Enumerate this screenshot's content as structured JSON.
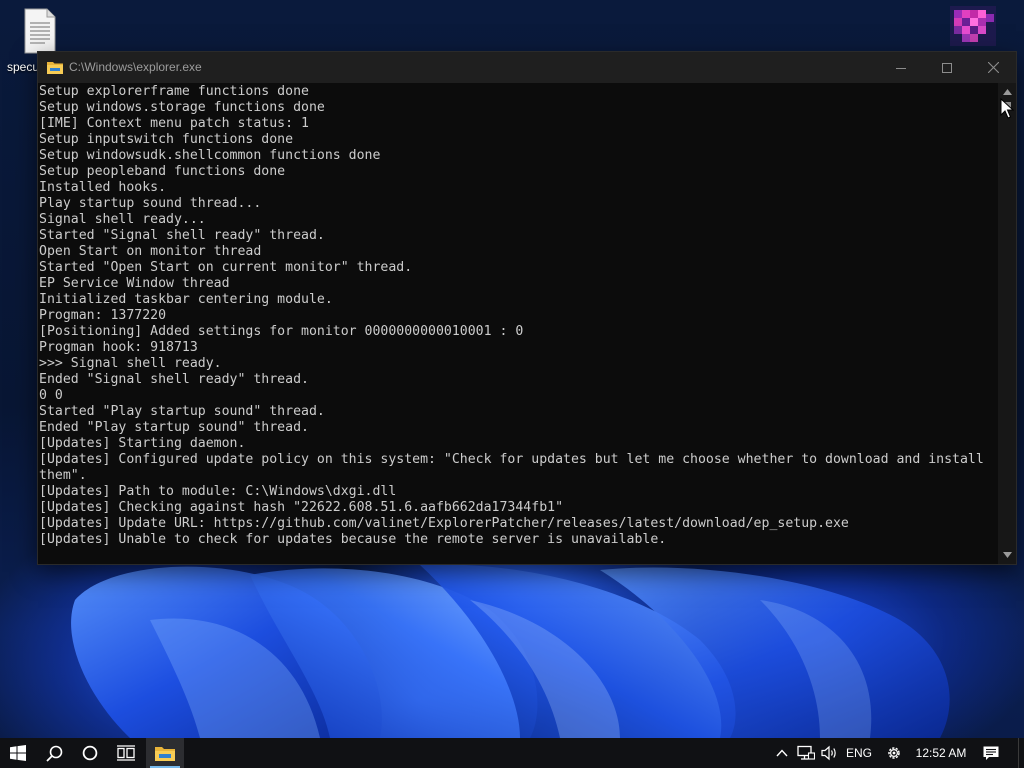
{
  "desktop": {
    "icons": [
      {
        "label": "specu",
        "icon": "document-icon"
      }
    ],
    "corner_icon": "pixelated-app-icon"
  },
  "window": {
    "title": "C:\\Windows\\explorer.exe",
    "app_icon": "folder-icon",
    "buttons": {
      "minimize": "minimize-icon",
      "maximize": "maximize-icon",
      "close": "close-icon"
    }
  },
  "console": {
    "lines": [
      "Setup explorerframe functions done",
      "Setup windows.storage functions done",
      "[IME] Context menu patch status: 1",
      "Setup inputswitch functions done",
      "Setup windowsudk.shellcommon functions done",
      "Setup peopleband functions done",
      "Installed hooks.",
      "Play startup sound thread...",
      "Signal shell ready...",
      "Started \"Signal shell ready\" thread.",
      "Open Start on monitor thread",
      "Started \"Open Start on current monitor\" thread.",
      "EP Service Window thread",
      "Initialized taskbar centering module.",
      "Progman: 1377220",
      "[Positioning] Added settings for monitor 0000000000010001 : 0",
      "Progman hook: 918713",
      ">>> Signal shell ready.",
      "Ended \"Signal shell ready\" thread.",
      "0 0",
      "Started \"Play startup sound\" thread.",
      "Ended \"Play startup sound\" thread.",
      "[Updates] Starting daemon.",
      "[Updates] Configured update policy on this system: \"Check for updates but let me choose whether to download and install",
      "them\".",
      "[Updates] Path to module: C:\\Windows\\dxgi.dll",
      "[Updates] Checking against hash \"22622.608.51.6.aafb662da17344fb1\"",
      "[Updates] Update URL: https://github.com/valinet/ExplorerPatcher/releases/latest/download/ep_setup.exe",
      "[Updates] Unable to check for updates because the remote server is unavailable."
    ]
  },
  "taskbar": {
    "start_icon": "windows-start-icon",
    "search_icon": "search-icon",
    "cortana_icon": "cortana-circle-icon",
    "taskview_icon": "task-view-icon",
    "pinned": [
      {
        "name": "File Explorer",
        "icon": "folder-icon",
        "active": true
      }
    ],
    "tray": {
      "language": "ENG",
      "time": "12:52 AM"
    }
  },
  "colors": {
    "console_bg": "#0c0c0c",
    "console_text": "#cccccc",
    "titlebar_bg": "#1f1f1f",
    "taskbar_bg": "#101114",
    "accent": "#76b9ed"
  }
}
